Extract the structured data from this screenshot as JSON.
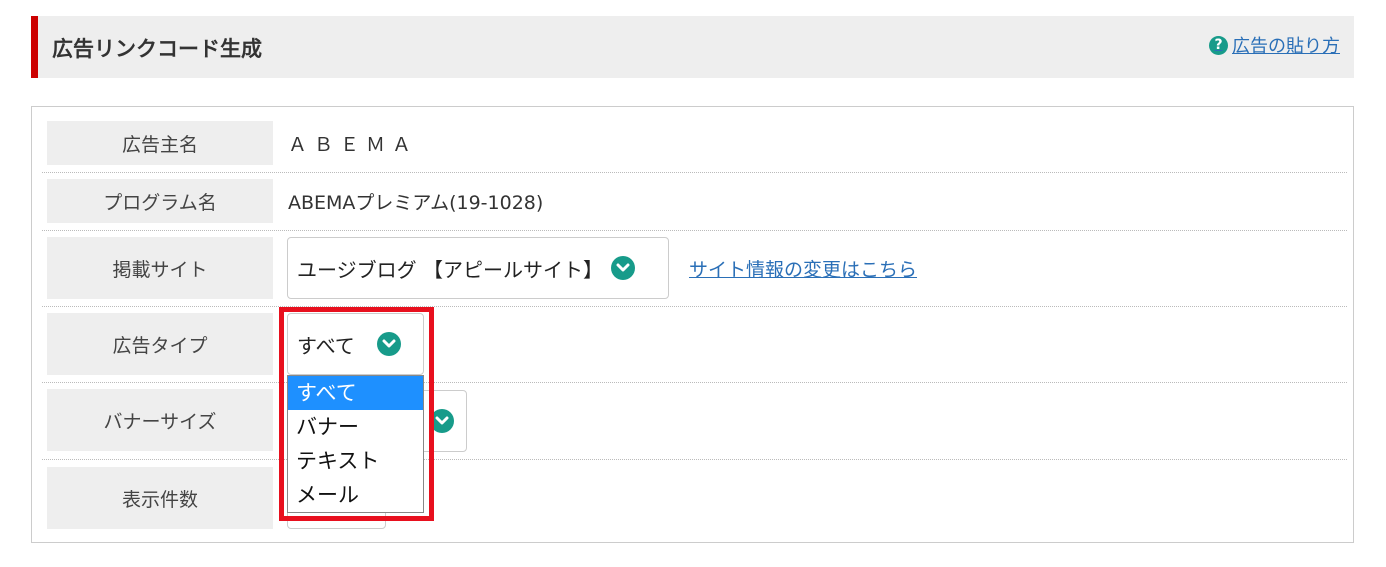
{
  "header": {
    "title": "広告リンクコード生成",
    "help_link": "広告の貼り方",
    "help_icon_glyph": "?"
  },
  "form": {
    "advertiser": {
      "label": "広告主名",
      "value": "ＡＢＥＭＡ"
    },
    "program": {
      "label": "プログラム名",
      "value": "ABEMAプレミアム(19-1028)"
    },
    "site": {
      "label": "掲載サイト",
      "selected": "ユージブログ 【アピールサイト】",
      "change_link": "サイト情報の変更はこちら"
    },
    "ad_type": {
      "label": "広告タイプ",
      "selected": "すべて",
      "options": [
        "すべて",
        "バナー",
        "テキスト",
        "メール"
      ]
    },
    "banner_size": {
      "label": "バナーサイズ"
    },
    "display_count": {
      "label": "表示件数"
    }
  },
  "colors": {
    "accent_red": "#cc0000",
    "highlight_red": "#e8101e",
    "teal_icon": "#179b8a",
    "link_blue": "#2a6fb7",
    "selected_blue": "#1e90ff"
  },
  "icons": {
    "help": "question-circle-icon",
    "select": "chevron-down-circle-icon"
  }
}
